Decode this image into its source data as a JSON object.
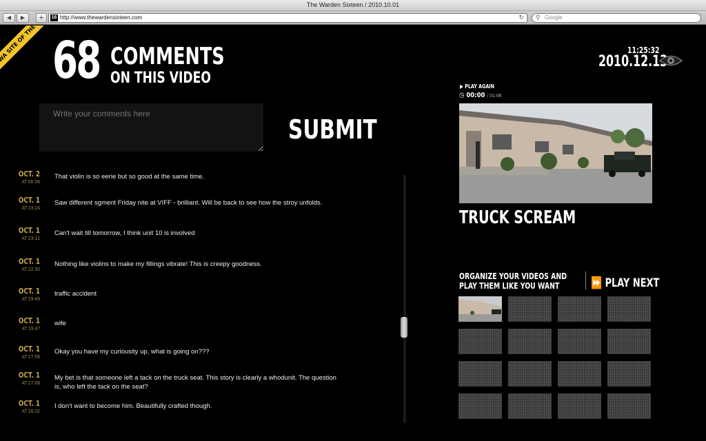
{
  "window": {
    "title": "The Warden Sixteen / 2010.10.01"
  },
  "browser": {
    "back_label": "◀",
    "forward_label": "▶",
    "add_label": "+",
    "favicon_text": "16",
    "url": "http://www.thewardensixteen.com",
    "reload_label": "↻",
    "search_placeholder": "Google"
  },
  "badge": {
    "text": "FWA SITE OF THE DAY",
    "color": "#f2c42a"
  },
  "header": {
    "comment_count": "68",
    "comments_label": "COMMENTS",
    "on_video_label": "ON THIS VIDEO"
  },
  "comment_form": {
    "placeholder": "Write your comments here",
    "submit_label": "SUBMIT"
  },
  "comments": [
    {
      "date": "OCT. 2",
      "time": "AT 00:56",
      "text": "That violin is so eerie but so good at the same time."
    },
    {
      "date": "OCT. 1",
      "time": "AT 23:24",
      "text": "Saw different sgment Friday nite at VIFF - brilliant. Will be back to see how the stroy unfolds."
    },
    {
      "date": "OCT. 1",
      "time": "AT 23:11",
      "text": "Can't wait till tomorrow, I think unit 10 is involved"
    },
    {
      "date": "OCT. 1",
      "time": "AT 22:30",
      "text": "Nothing like violins to make my fillings vibrate! This is creepy goodness."
    },
    {
      "date": "OCT. 1",
      "time": "AT 19:49",
      "text": "traffic accident"
    },
    {
      "date": "OCT. 1",
      "time": "AT 19:47",
      "text": "wife"
    },
    {
      "date": "OCT. 1",
      "time": "AT 17:56",
      "text": "Okay you have my curiousity up, what is going on???"
    },
    {
      "date": "OCT. 1",
      "time": "AT 17:08",
      "text": "My bet is that someone left a tack on the truck seat. This story is clearly a whodunit. The question is, who left the tack on the seat?"
    },
    {
      "date": "OCT. 1",
      "time": "AT 16:32",
      "text": "I don't want to become him. Beautifully crafted though."
    }
  ],
  "clock": {
    "time": "11:25:32",
    "date": "2010.12.13"
  },
  "player": {
    "play_again_label": "PLAY AGAIN",
    "current_time": "00:00",
    "duration": "/ 01:06",
    "video_title": "TRUCK SCREAM"
  },
  "playlist": {
    "organize_label": "ORGANIZE YOUR VIDEOS AND PLAY THEM LIKE YOU WANT",
    "play_next_label": "PLAY NEXT",
    "thumbnail_count": 16
  },
  "colors": {
    "accent_gold": "#c9a84a",
    "background": "#000000",
    "text": "#ffffff"
  }
}
